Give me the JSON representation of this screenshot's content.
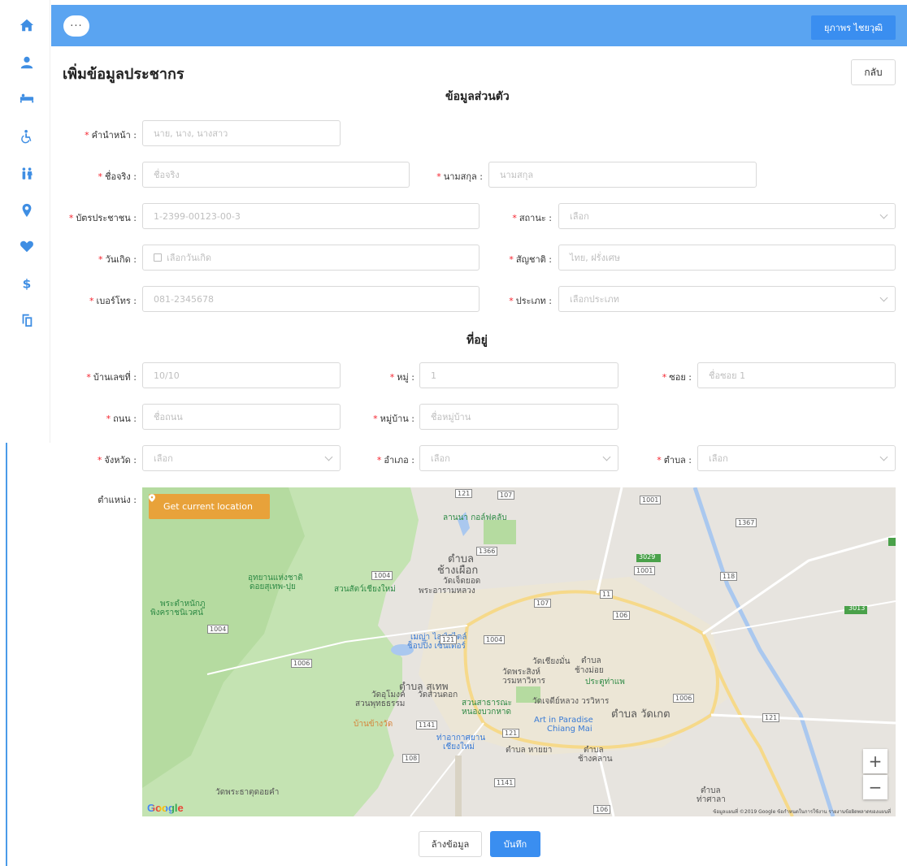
{
  "header": {
    "menu_label": "···",
    "user_name": "ยุภาพร ไชยวุฒิ"
  },
  "sidebar": {
    "items": [
      {
        "icon": "home-icon"
      },
      {
        "icon": "user-icon"
      },
      {
        "icon": "bed-icon"
      },
      {
        "icon": "wheelchair-icon"
      },
      {
        "icon": "family-icon"
      },
      {
        "icon": "location-pin-icon"
      },
      {
        "icon": "heart-icon"
      },
      {
        "icon": "dollar-icon"
      },
      {
        "icon": "copy-icon"
      }
    ],
    "accent_color": "#3f8ee3"
  },
  "page": {
    "title": "เพิ่มข้อมูลประชากร",
    "back_label": "กลับ"
  },
  "personal": {
    "section_title": "ข้อมูลส่วนตัว",
    "prefix": {
      "label": "คำนำหน้า",
      "placeholder": "นาย, นาง, นางสาว"
    },
    "first_name": {
      "label": "ชื่อจริง",
      "placeholder": "ชื่อจริง"
    },
    "last_name": {
      "label": "นามสกุล",
      "placeholder": "นามสกุล"
    },
    "id_card": {
      "label": "บัตรประชาชน",
      "placeholder": "1-2399-00123-00-3"
    },
    "status": {
      "label": "สถานะ",
      "placeholder": "เลือก"
    },
    "birthdate": {
      "label": "วันเกิด",
      "placeholder": "เลือกวันเกิด"
    },
    "nationality": {
      "label": "สัญชาติ",
      "placeholder": "ไทย, ฝรั่งเศษ"
    },
    "phone": {
      "label": "เบอร์โทร",
      "placeholder": "081-2345678"
    },
    "type": {
      "label": "ประเภท",
      "placeholder": "เลือกประเภท"
    }
  },
  "address": {
    "section_title": "ที่อยู่",
    "house_no": {
      "label": "บ้านเลขที่",
      "placeholder": "10/10"
    },
    "moo": {
      "label": "หมู่",
      "placeholder": "1"
    },
    "soi": {
      "label": "ซอย",
      "placeholder": "ชื่อซอย 1"
    },
    "road": {
      "label": "ถนน",
      "placeholder": "ชื่อถนน"
    },
    "village": {
      "label": "หมู่บ้าน",
      "placeholder": "ชื่อหมู่บ้าน"
    },
    "province": {
      "label": "จังหวัด",
      "placeholder": "เลือก"
    },
    "district": {
      "label": "อำเภอ",
      "placeholder": "เลือก"
    },
    "subdistrict": {
      "label": "ตำบล",
      "placeholder": "เลือก"
    },
    "location_label": "ตำแหน่ง"
  },
  "map": {
    "location_button": "Get current location",
    "zoom_in": "+",
    "zoom_out": "−",
    "google_logo": "Google",
    "footer": "ข้อมูลแผนที่ ©2019 Google   ข้อกำหนดในการใช้งาน   รายงานข้อผิดพลาดของแผนที่",
    "labels": [
      "ลานนา กอล์ฟคลับ",
      "ตำบล",
      "ช้างเผือก",
      "วัดเจ็ดยอด",
      "พระอารามหลวง",
      "อุทยานแห่งชาติ",
      "ดอยสุเทพ-ปุย",
      "สวนสัตว์เชียงใหม่",
      "พระตำหนักภู",
      "พิงคราชนิเวศน์",
      "เมญ่า ไลฟ์สไตล์",
      "ช็อปปิ้ง เซ็นเตอร์",
      "วัดเชียงมั่น",
      "วัดพระสิงห์",
      "วรมหาวิหาร",
      "ตำบล สุเทพ",
      "วัดสวนดอก",
      "ตำบล",
      "ช้างม่อย",
      "ประตูท่าแพ",
      "วัดอุโมงค์",
      "สวนพุทธธรรม",
      "สวนสาธารณะ",
      "หนองบวกหาด",
      "วัดเจดีย์หลวง วรวิหาร",
      "ตำบล วัดเกต",
      "บ้านข้างวัด",
      "Art in Paradise",
      "Chiang Mai",
      "ท่าอากาศยาน",
      "เชียงใหม่",
      "ตำบล หายยา",
      "ตำบล",
      "ช้างคลาน",
      "วัดพระธาตุดอยคำ",
      "ตำบล",
      "ท่าศาลา"
    ],
    "road_numbers": [
      "121",
      "107",
      "1001",
      "1367",
      "3029",
      "1366",
      "1004",
      "1001",
      "118",
      "107",
      "11",
      "3013",
      "106",
      "1004",
      "121",
      "1004",
      "1006",
      "1006",
      "121",
      "1141",
      "121",
      "108",
      "1141",
      "106"
    ]
  },
  "footer": {
    "clear_label": "ล้างข้อมูล",
    "save_label": "บันทึก"
  }
}
